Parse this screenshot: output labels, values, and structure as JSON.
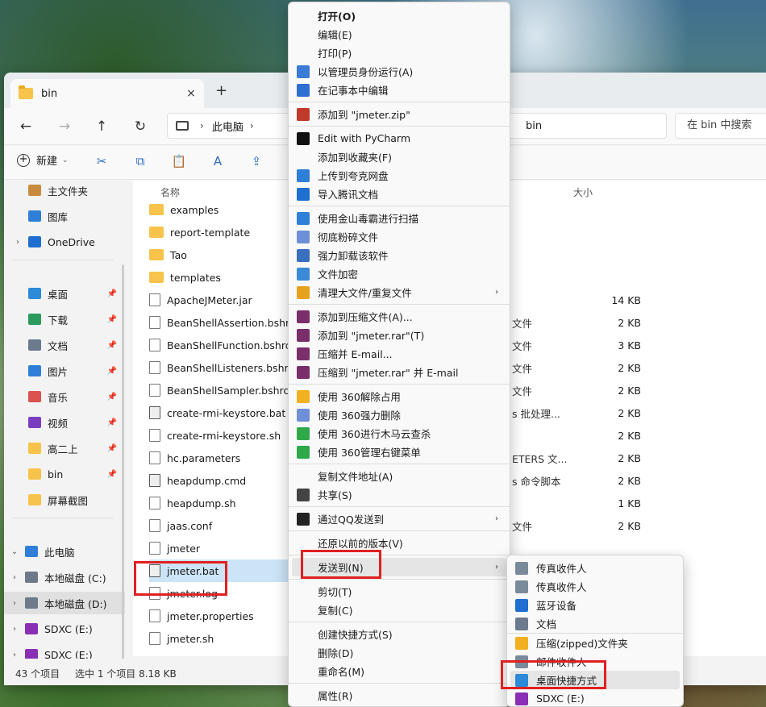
{
  "tab": {
    "title": "bin",
    "close": "×",
    "new": "+"
  },
  "nav": {
    "back": "←",
    "forward": "→",
    "up": "↑",
    "refresh": "↻"
  },
  "address": {
    "sep": "›",
    "this_pc": "此电脑",
    "current": "bin",
    "sep2": "›"
  },
  "search": {
    "placeholder": "在 bin 中搜索"
  },
  "toolbar": {
    "new_label": "新建",
    "new_chev": "⌄",
    "cut": "✂",
    "copy": "⧉",
    "paste": "📋",
    "rename": "A",
    "share": "⇪"
  },
  "sidebar": [
    {
      "label": "主文件夹",
      "exp": "",
      "color": "#c98c3e",
      "pin": ""
    },
    {
      "label": "图库",
      "exp": "",
      "color": "#2f7fd8",
      "pin": ""
    },
    {
      "label": "OneDrive",
      "exp": "›",
      "color": "#1f6fd1",
      "pin": ""
    },
    {
      "label": "桌面",
      "exp": "",
      "color": "#2c8ad8",
      "pin": "📌"
    },
    {
      "label": "下载",
      "exp": "",
      "color": "#2b9a5c",
      "pin": "📌"
    },
    {
      "label": "文档",
      "exp": "",
      "color": "#6b7a8c",
      "pin": "📌"
    },
    {
      "label": "图片",
      "exp": "",
      "color": "#2f7fd8",
      "pin": "📌"
    },
    {
      "label": "音乐",
      "exp": "",
      "color": "#d9534f",
      "pin": "📌"
    },
    {
      "label": "视频",
      "exp": "",
      "color": "#7a3fc1",
      "pin": "📌"
    },
    {
      "label": "高二上",
      "exp": "",
      "color": "#f7c34a",
      "pin": "📌"
    },
    {
      "label": "bin",
      "exp": "",
      "color": "#f7c34a",
      "pin": "📌"
    },
    {
      "label": "屏幕截图",
      "exp": "",
      "color": "#f7c34a",
      "pin": ""
    },
    {
      "label": "此电脑",
      "exp": "⌄",
      "color": "#2f7fd8",
      "pin": ""
    },
    {
      "label": "本地磁盘 (C:)",
      "exp": "›",
      "color": "#6c7a8a",
      "pin": ""
    },
    {
      "label": "本地磁盘 (D:)",
      "exp": "›",
      "color": "#6c7a8a",
      "pin": ""
    },
    {
      "label": "SDXC (E:)",
      "exp": "›",
      "color": "#8a2fb5",
      "pin": ""
    },
    {
      "label": "SDXC (E:)",
      "exp": "›",
      "color": "#8a2fb5",
      "pin": ""
    }
  ],
  "columns": {
    "name": "名称",
    "size": "大小"
  },
  "files": [
    {
      "name": "examples",
      "kind": "folder",
      "type": "",
      "size": ""
    },
    {
      "name": "report-template",
      "kind": "folder",
      "type": "",
      "size": ""
    },
    {
      "name": "Tao",
      "kind": "folder",
      "type": "",
      "size": ""
    },
    {
      "name": "templates",
      "kind": "folder",
      "type": "",
      "size": ""
    },
    {
      "name": "ApacheJMeter.jar",
      "kind": "file",
      "type": "",
      "size": "14 KB"
    },
    {
      "name": "BeanShellAssertion.bshrc",
      "kind": "file",
      "type": "文件",
      "size": "2 KB"
    },
    {
      "name": "BeanShellFunction.bshrc",
      "kind": "file",
      "type": "文件",
      "size": "3 KB"
    },
    {
      "name": "BeanShellListeners.bshrc",
      "kind": "file",
      "type": "文件",
      "size": "2 KB"
    },
    {
      "name": "BeanShellSampler.bshrc",
      "kind": "file",
      "type": "文件",
      "size": "2 KB"
    },
    {
      "name": "create-rmi-keystore.bat",
      "kind": "bat",
      "type": "s 批处理...",
      "size": "2 KB"
    },
    {
      "name": "create-rmi-keystore.sh",
      "kind": "file",
      "type": "",
      "size": "2 KB"
    },
    {
      "name": "hc.parameters",
      "kind": "file",
      "type": "ETERS 文...",
      "size": "2 KB"
    },
    {
      "name": "heapdump.cmd",
      "kind": "bat",
      "type": "s 命令脚本",
      "size": "2 KB"
    },
    {
      "name": "heapdump.sh",
      "kind": "file",
      "type": "",
      "size": "1 KB"
    },
    {
      "name": "jaas.conf",
      "kind": "file",
      "type": "文件",
      "size": "2 KB"
    },
    {
      "name": "jmeter",
      "kind": "file",
      "type": "",
      "size": ""
    },
    {
      "name": "jmeter.bat",
      "kind": "bat",
      "type": "",
      "size": ""
    },
    {
      "name": "jmeter.log",
      "kind": "file",
      "type": "",
      "size": ""
    },
    {
      "name": "jmeter.properties",
      "kind": "file",
      "type": "",
      "size": ""
    },
    {
      "name": "jmeter.sh",
      "kind": "file",
      "type": "",
      "size": ""
    }
  ],
  "status": {
    "count": "43 个项目",
    "selected": "选中 1 个项目  8.18 KB"
  },
  "context_menu": [
    {
      "label": "打开(O)",
      "bold": true,
      "color": "",
      "arrow": ""
    },
    {
      "label": "编辑(E)",
      "color": "",
      "arrow": ""
    },
    {
      "label": "打印(P)",
      "color": "",
      "arrow": ""
    },
    {
      "label": "以管理员身份运行(A)",
      "color": "#3a7bd5",
      "arrow": ""
    },
    {
      "label": "在记事本中编辑",
      "color": "#2f6fd1",
      "arrow": ""
    },
    {
      "sep": true
    },
    {
      "label": "添加到 \"jmeter.zip\"",
      "color": "#c0392b",
      "arrow": ""
    },
    {
      "sep": true
    },
    {
      "label": "Edit with PyCharm",
      "color": "#111111",
      "arrow": ""
    },
    {
      "label": "添加到收藏夹(F)",
      "color": "",
      "arrow": ""
    },
    {
      "label": "上传到夸克网盘",
      "color": "#2f7fd8",
      "arrow": ""
    },
    {
      "label": "导入腾讯文档",
      "color": "#1f6fd1",
      "arrow": ""
    },
    {
      "sep": true
    },
    {
      "label": "使用金山毒霸进行扫描",
      "color": "#2f7fd8",
      "arrow": ""
    },
    {
      "label": "彻底粉碎文件",
      "color": "#6f8fd8",
      "arrow": ""
    },
    {
      "label": "强力卸载该软件",
      "color": "#3a6fc0",
      "arrow": ""
    },
    {
      "label": "文件加密",
      "color": "#3a8ad8",
      "arrow": ""
    },
    {
      "label": "清理大文件/重复文件",
      "color": "#e6a21d",
      "arrow": "›"
    },
    {
      "sep": true
    },
    {
      "label": "添加到压缩文件(A)...",
      "color": "#7a2f6a",
      "arrow": ""
    },
    {
      "label": "添加到 \"jmeter.rar\"(T)",
      "color": "#7a2f6a",
      "arrow": ""
    },
    {
      "label": "压缩并 E-mail...",
      "color": "#7a2f6a",
      "arrow": ""
    },
    {
      "label": "压缩到 \"jmeter.rar\" 并 E-mail",
      "color": "#7a2f6a",
      "arrow": ""
    },
    {
      "sep": true
    },
    {
      "label": "使用 360解除占用",
      "color": "#f0b020",
      "arrow": ""
    },
    {
      "label": "使用 360强力删除",
      "color": "#6f8fd8",
      "arrow": ""
    },
    {
      "label": "使用 360进行木马云查杀",
      "color": "#2fa84a",
      "arrow": ""
    },
    {
      "label": "使用 360管理右键菜单",
      "color": "#2fa84a",
      "arrow": ""
    },
    {
      "sep": true
    },
    {
      "label": "复制文件地址(A)",
      "color": "",
      "arrow": ""
    },
    {
      "label": "共享(S)",
      "color": "#444444",
      "arrow": ""
    },
    {
      "sep": true
    },
    {
      "label": "通过QQ发送到",
      "color": "#222222",
      "arrow": "›"
    },
    {
      "sep": true
    },
    {
      "label": "还原以前的版本(V)",
      "color": "",
      "arrow": ""
    },
    {
      "sep": true
    },
    {
      "label": "发送到(N)",
      "color": "",
      "arrow": "›",
      "hl": true
    },
    {
      "sep": true
    },
    {
      "label": "剪切(T)",
      "color": "",
      "arrow": ""
    },
    {
      "label": "复制(C)",
      "color": "",
      "arrow": ""
    },
    {
      "sep": true
    },
    {
      "label": "创建快捷方式(S)",
      "color": "",
      "arrow": ""
    },
    {
      "label": "删除(D)",
      "color": "",
      "arrow": ""
    },
    {
      "label": "重命名(M)",
      "color": "",
      "arrow": ""
    },
    {
      "sep": true
    },
    {
      "label": "属性(R)",
      "color": "",
      "arrow": ""
    }
  ],
  "sendto_menu": [
    {
      "label": "传真收件人",
      "color": "#7a8a9a"
    },
    {
      "label": "传真收件人",
      "color": "#7a8a9a"
    },
    {
      "label": "蓝牙设备",
      "color": "#1f6fd1"
    },
    {
      "label": "文档",
      "color": "#6b7a8c"
    },
    {
      "label": "压缩(zipped)文件夹",
      "color": "#f0b020"
    },
    {
      "label": "邮件收件人",
      "color": "#7a8a9a"
    },
    {
      "label": "桌面快捷方式",
      "color": "#2c8ad8",
      "hl": true
    },
    {
      "label": "SDXC (E:)",
      "color": "#8a2fb5"
    }
  ],
  "icons": {
    "accent": "#2c6dbf",
    "highlight_box": "#e12020"
  }
}
